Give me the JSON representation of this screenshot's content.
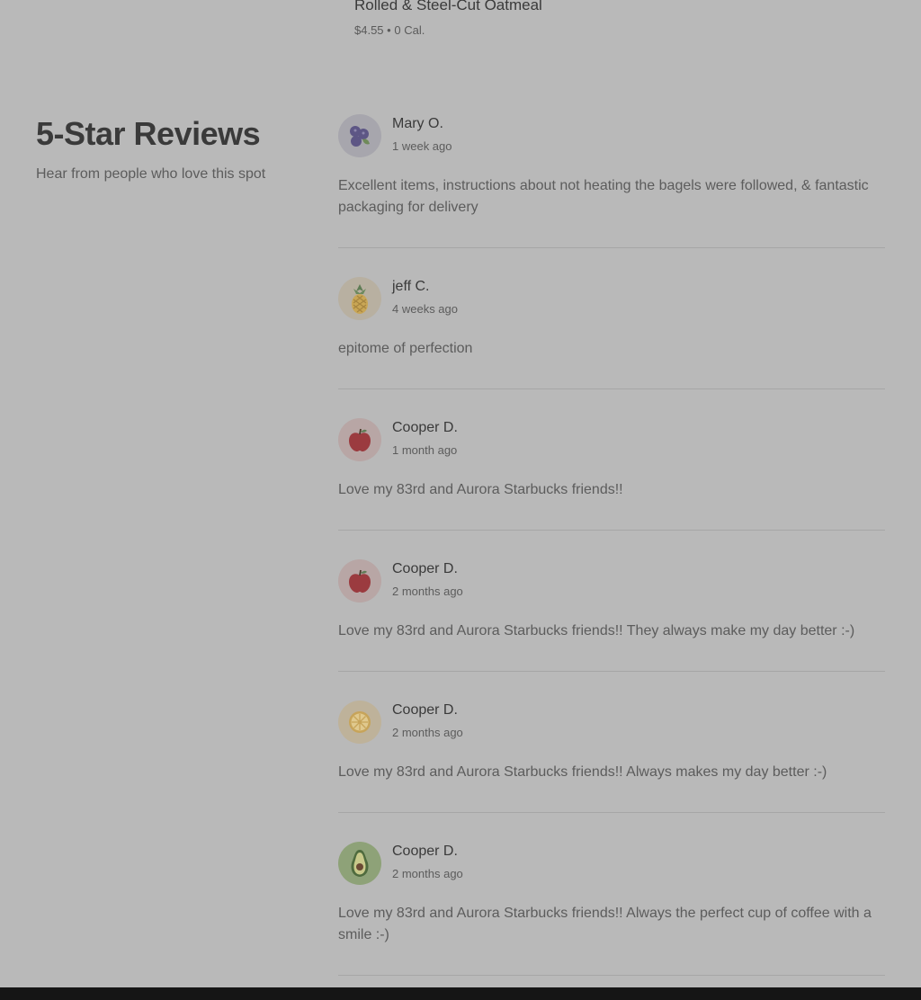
{
  "menu_item": {
    "name": "Rolled & Steel-Cut Oatmeal",
    "price": "$4.55",
    "separator": "•",
    "calories": "0 Cal."
  },
  "section": {
    "title": "5-Star Reviews",
    "subtitle": "Hear from people who love this spot"
  },
  "reviews": [
    {
      "name": "Mary O.",
      "date": "1 week ago",
      "text": "Excellent items, instructions about not heating the bagels were followed, & fantastic packaging for delivery",
      "avatar_icon": "blueberries-icon",
      "avatar_bg": "#a7a6ad"
    },
    {
      "name": "jeff C.",
      "date": "4 weeks ago",
      "text": "epitome of perfection",
      "avatar_icon": "pineapple-icon",
      "avatar_bg": "#b8b0a1"
    },
    {
      "name": "Cooper D.",
      "date": "1 month ago",
      "text": "Love my 83rd and Aurora Starbucks friends!!",
      "avatar_icon": "apple-icon",
      "avatar_bg": "#b8a6a5"
    },
    {
      "name": "Cooper D.",
      "date": "2 months ago",
      "text": "Love my 83rd and Aurora Starbucks friends!! They always make my day better :-)",
      "avatar_icon": "apple-icon",
      "avatar_bg": "#b8a6a5"
    },
    {
      "name": "Cooper D.",
      "date": "2 months ago",
      "text": "Love my 83rd and Aurora Starbucks friends!! Always makes my day better :-)",
      "avatar_icon": "lemon-icon",
      "avatar_bg": "#beb29a"
    },
    {
      "name": "Cooper D.",
      "date": "2 months ago",
      "text": "Love my 83rd and Aurora Starbucks friends!! Always the perfect cup of coffee with a smile :-)",
      "avatar_icon": "avocado-icon",
      "avatar_bg": "#8ea278"
    }
  ]
}
